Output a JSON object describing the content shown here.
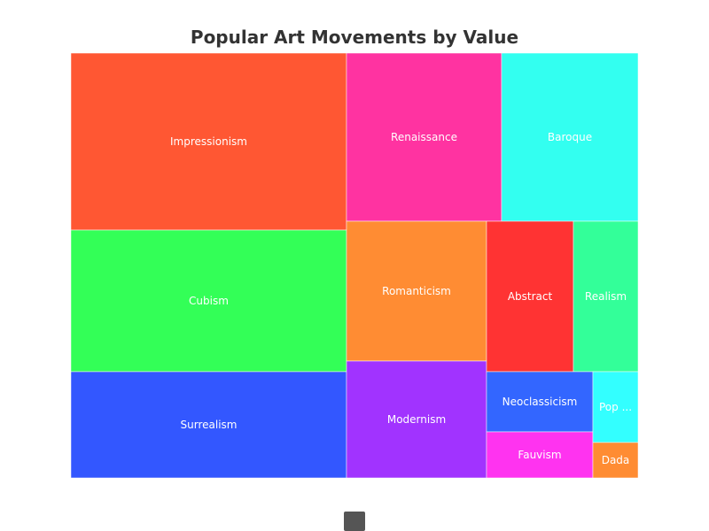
{
  "chart_data": {
    "type": "treemap",
    "title": "Popular Art Movements by Value",
    "items": [
      {
        "name": "Impressionism",
        "label": "Impressionism",
        "value": 15.6,
        "color": "#ff5733"
      },
      {
        "name": "Cubism",
        "label": "Cubism",
        "value": 12.5,
        "color": "#33ff57"
      },
      {
        "name": "Surrealism",
        "label": "Surrealism",
        "value": 9.3,
        "color": "#3357ff"
      },
      {
        "name": "Renaissance",
        "label": "Renaissance",
        "value": 8.6,
        "color": "#ff33a1"
      },
      {
        "name": "Baroque",
        "label": "Baroque",
        "value": 7.5,
        "color": "#33fff0"
      },
      {
        "name": "Romanticism",
        "label": "Romanticism",
        "value": 6.3,
        "color": "#ff8c33"
      },
      {
        "name": "Modernism",
        "label": "Modernism",
        "value": 5.2,
        "color": "#a133ff"
      },
      {
        "name": "Abstract",
        "label": "Abstract",
        "value": 4.8,
        "color": "#ff3333"
      },
      {
        "name": "Realism",
        "label": "Realism",
        "value": 3.6,
        "color": "#33ff99"
      },
      {
        "name": "Neoclassicism",
        "label": "Neoclassicism",
        "value": 2.9,
        "color": "#3366ff"
      },
      {
        "name": "Fauvism",
        "label": "Fauvism",
        "value": 2.1,
        "color": "#ff33f0"
      },
      {
        "name": "Pop Art",
        "label": "Pop ...",
        "value": 1.6,
        "color": "#33ffff"
      },
      {
        "name": "Dada",
        "label": "Dada",
        "value": 0.8,
        "color": "#ff8c33"
      }
    ],
    "legend": {
      "color": "#555555"
    }
  }
}
